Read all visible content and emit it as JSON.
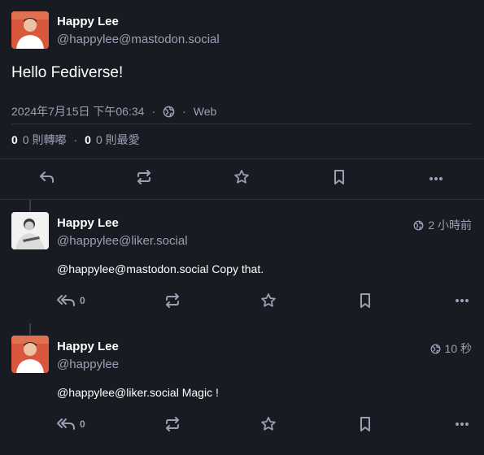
{
  "main_post": {
    "display_name": "Happy Lee",
    "handle": "@happylee@mastodon.social",
    "content": "Hello Fediverse!",
    "timestamp": "2024年7月15日 下午06:34",
    "separator": "·",
    "app": "Web",
    "boosts_count": "0",
    "boosts_label": "0 則轉嘟",
    "favs_count": "0",
    "favs_label": "0 則最愛"
  },
  "replies": [
    {
      "display_name": "Happy Lee",
      "handle": "@happylee@liker.social",
      "time": "2 小時前",
      "mention": "@happylee@mastodon.social",
      "text": "Copy that.",
      "reply_count": "0"
    },
    {
      "display_name": "Happy Lee",
      "handle": "@happylee",
      "time": "10 秒",
      "mention": "@happylee@liker.social",
      "text": "Magic !",
      "reply_count": "0"
    }
  ],
  "colors": {
    "background": "#191b22",
    "muted": "#9aa0b4",
    "divider": "#2e313c",
    "avatar_accent": "#d9583d"
  },
  "icons": [
    "reply-icon",
    "boost-icon",
    "favourite-icon",
    "bookmark-icon",
    "more-icon",
    "globe-icon",
    "reply-all-icon"
  ]
}
